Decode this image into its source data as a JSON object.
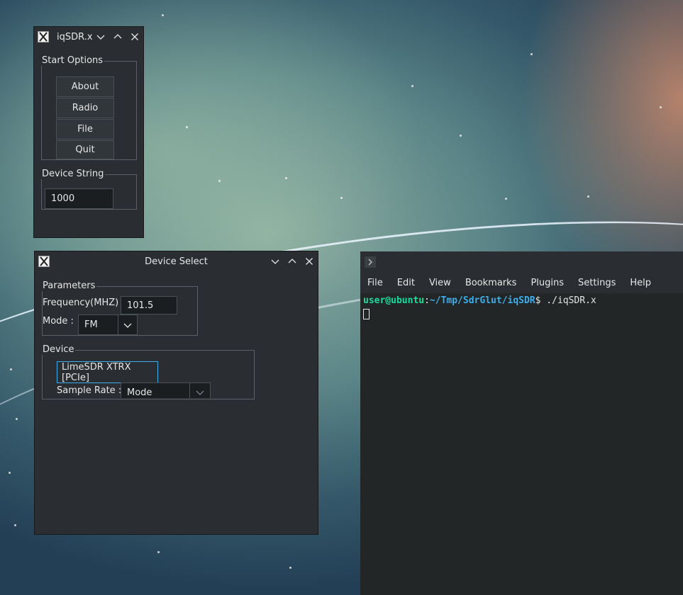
{
  "desktop": {
    "wallpaper": "starry-teal-wallpaper"
  },
  "iqsdr_window": {
    "title": "iqSDR.x",
    "start_options": {
      "legend": "Start Options",
      "buttons": [
        {
          "label": "About"
        },
        {
          "label": "Radio"
        },
        {
          "label": "File"
        },
        {
          "label": "Quit"
        }
      ]
    },
    "device_string": {
      "legend": "Device String",
      "value": "1000"
    }
  },
  "device_select_window": {
    "title": "Device Select",
    "parameters": {
      "legend": "Parameters",
      "frequency_label": "Frequency(MHZ)",
      "frequency_value": "101.5",
      "mode_label": "Mode :",
      "mode_value": "FM"
    },
    "device": {
      "legend": "Device",
      "device_name": "LimeSDR XTRX [PCIe]",
      "sample_rate_label": "Sample Rate :",
      "sample_rate_value": "Mode"
    }
  },
  "terminal_window": {
    "menu": [
      "File",
      "Edit",
      "View",
      "Bookmarks",
      "Plugins",
      "Settings",
      "Help"
    ],
    "prompt_user": "user@ubuntu",
    "prompt_sep": ":",
    "prompt_path": "~/Tmp/SdrGlut/iqSDR",
    "prompt_symbol": "$",
    "command": " ./iqSDR.x"
  },
  "colors": {
    "window_bg": "#2a2e32",
    "terminal_bg": "#232627",
    "prompt_user": "#1cdc9a",
    "prompt_path": "#3daee9",
    "focus_accent": "#3daee9"
  }
}
